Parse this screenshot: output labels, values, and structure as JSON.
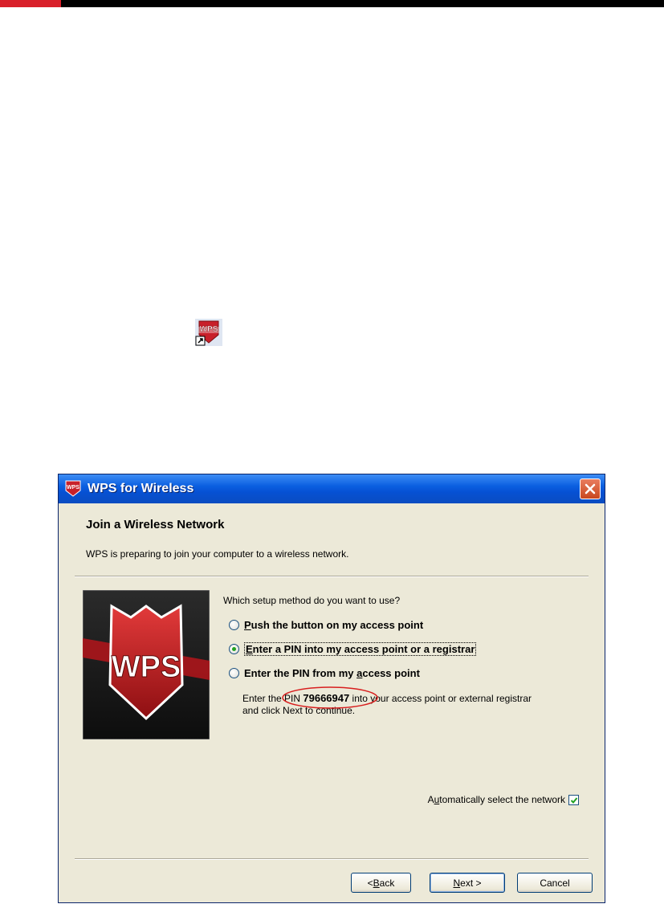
{
  "colors": {
    "titlebar": "#0651d4",
    "accent_red": "#d9202a",
    "window_bg": "#ece9d8"
  },
  "desktop": {
    "shortcut_icon_text": "WPS"
  },
  "window": {
    "title": "WPS for Wireless",
    "header": {
      "title": "Join a Wireless Network",
      "subtitle": "WPS is preparing to join your computer to a wireless network."
    },
    "image_text": "WPS",
    "question": "Which setup method do you want to use?",
    "options": [
      {
        "pre": "",
        "key": "P",
        "post": "ush the button on my access point",
        "selected": false
      },
      {
        "pre": "",
        "key": "E",
        "post": "nter a PIN into my access point or a registrar",
        "selected": true
      },
      {
        "pre": "Enter the PIN from my ",
        "key": "a",
        "post": "ccess point",
        "selected": false
      }
    ],
    "pin_instruction": {
      "before": "Enter the PIN ",
      "pin": "79666947",
      "after": " into your access point or external registrar",
      "line2": "and click Next to continue."
    },
    "auto_select": {
      "pre": "A",
      "key": "u",
      "post": "tomatically select the network",
      "checked": true
    },
    "buttons": {
      "back": {
        "prefix": "< ",
        "key": "B",
        "rest": "ack"
      },
      "next": {
        "key": "N",
        "rest": "ext >"
      },
      "cancel": "Cancel"
    }
  }
}
